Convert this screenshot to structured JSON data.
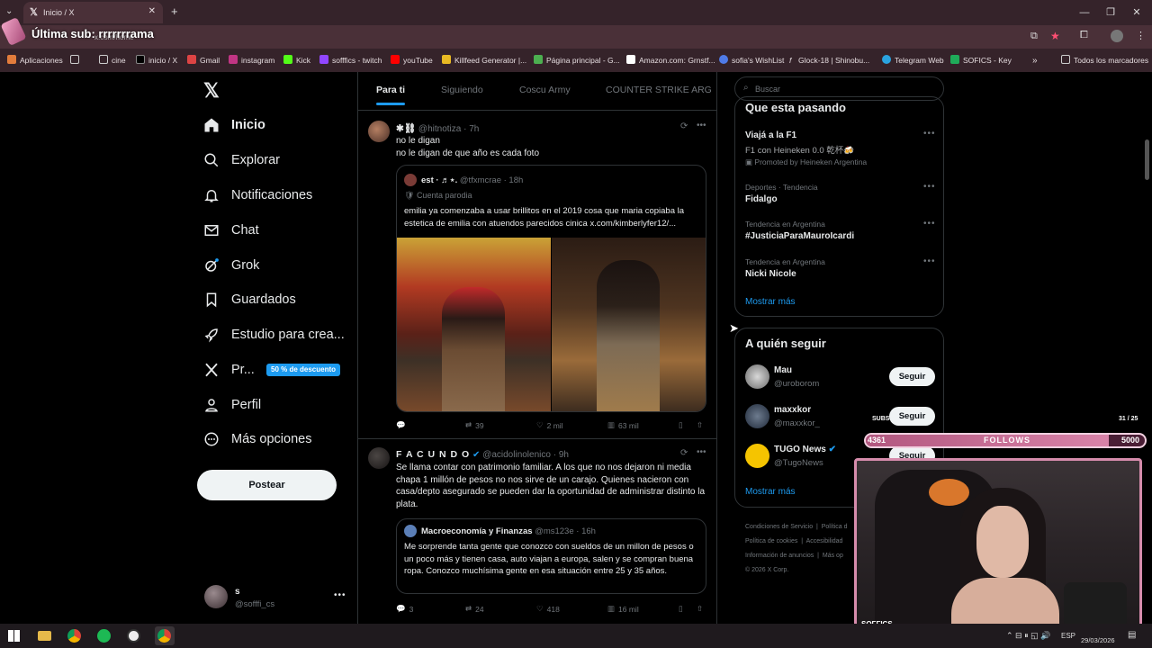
{
  "browser": {
    "tab_title": "Inicio / X",
    "overlay_text": "Última sub: rrrrrrrama",
    "address_hint": "x.com/home",
    "bookmarks": [
      "Aplicaciones",
      "cine",
      "inicio / X",
      "Gmail",
      "instagram",
      "Kick",
      "sofffics - twitch",
      "youTube",
      "Killfeed Generator |...",
      "Página principal - G...",
      "Amazon.com: Grnstf...",
      "sofia's WishList",
      "Glock-18 | Shinobu...",
      "Telegram Web",
      "SOFICS - Key",
      "Todos los marcadores"
    ]
  },
  "sidebar": {
    "items": [
      {
        "label": "Inicio",
        "icon": "home-icon"
      },
      {
        "label": "Explorar",
        "icon": "search-icon"
      },
      {
        "label": "Notificaciones",
        "icon": "bell-icon"
      },
      {
        "label": "Chat",
        "icon": "mail-icon"
      },
      {
        "label": "Grok",
        "icon": "grok-icon"
      },
      {
        "label": "Guardados",
        "icon": "bookmark-icon"
      },
      {
        "label": "Estudio para crea...",
        "icon": "rocket-icon"
      },
      {
        "label": "Pr...",
        "icon": "x-icon"
      },
      {
        "label": "Perfil",
        "icon": "person-icon"
      },
      {
        "label": "Más opciones",
        "icon": "more-circle-icon"
      }
    ],
    "premium_badge": "50 % de descuento",
    "post_button": "Postear",
    "account": {
      "name": "s",
      "handle": "@sofffi_cs"
    }
  },
  "feed": {
    "tabs": [
      "Para ti",
      "Siguiendo",
      "Coscu Army",
      "COUNTER STRIKE ARG"
    ],
    "tweet1": {
      "name": "✱⛓",
      "handle": "@hitnotiza",
      "time": "· 7h",
      "text1": "no le digan",
      "text2": "no le digan de que año es cada foto",
      "quote": {
        "name": "est · ♬⋆.",
        "handle": "@tfxmcrae",
        "time": "· 18h",
        "badge": "Cuenta parodia",
        "text": "emilia ya comenzaba a usar brillitos en el 2019 cosa que maria copiaba la estetica de emilia con atuendos parecidos cinica  x.com/kimberlyfer12/..."
      },
      "stats": {
        "reposts": "39",
        "likes": "2 mil",
        "views": "63 mil"
      }
    },
    "tweet2": {
      "name": "F A C U N D O",
      "handle": "@acidolinolenico",
      "time": "· 9h",
      "text": "Se llama contar con patrimonio familiar. A los que no nos dejaron ni media chapa 1 millón de pesos no nos sirve de un carajo.  Quienes nacieron con casa/depto asegurado se pueden dar la oportunidad de administrar distinto la plata.",
      "quote": {
        "name": "Macroeconomía y Finanzas",
        "handle": "@ms123e",
        "time": "· 16h",
        "text": "Me sorprende tanta gente que conozco con sueldos de un millon de pesos o un poco más y tienen casa, auto viajan a europa, salen y se compran buena ropa. Conozco muchísima gente en esa situación entre 25 y 35 años."
      },
      "stats": {
        "replies": "3",
        "reposts": "24",
        "likes": "418",
        "views": "16 mil"
      }
    }
  },
  "right": {
    "search_placeholder": "Buscar",
    "trends_title": "Que esta pasando",
    "trends": [
      {
        "meta": "",
        "title": "Viajá a la F1",
        "sub": "F1 con Heineken 0.0 乾杯🍻",
        "promo": "Promoted by Heineken Argentina"
      },
      {
        "meta": "Deportes · Tendencia",
        "title": "Fidalgo"
      },
      {
        "meta": "Tendencia en Argentina",
        "title": "#JusticiaParaMauroIcardi"
      },
      {
        "meta": "Tendencia en Argentina",
        "title": "Nicki Nicole"
      }
    ],
    "show_more": "Mostrar más",
    "who_title": "A quién seguir",
    "who": [
      {
        "name": "Mau",
        "handle": "@uroborom"
      },
      {
        "name": "maxxkor",
        "handle": "@maxxkor_"
      },
      {
        "name": "TUGO News",
        "handle": "@TugoNews"
      }
    ],
    "follow_label": "Seguir",
    "show_more2": "Mostrar más",
    "footer": [
      "Condiciones de Servicio",
      "Política d",
      "Política de cookies",
      "Accesibilidad",
      "Información de anuncios",
      "Más op",
      "© 2026 X Corp."
    ]
  },
  "stream": {
    "subs_label": "SUBS",
    "subs_count": "31 / 25",
    "follows_left": "4361",
    "follows_label": "FOLLOWS",
    "follows_right": "5000",
    "follows_progress": 0.87,
    "cam_label": "SOFFICS"
  },
  "taskbar": {
    "lang": "ESP",
    "date": "29/03/2026"
  },
  "colors": {
    "accent": "#1d9bf0",
    "chrome": "#35232a",
    "stream_pink": "#c86a8e"
  }
}
